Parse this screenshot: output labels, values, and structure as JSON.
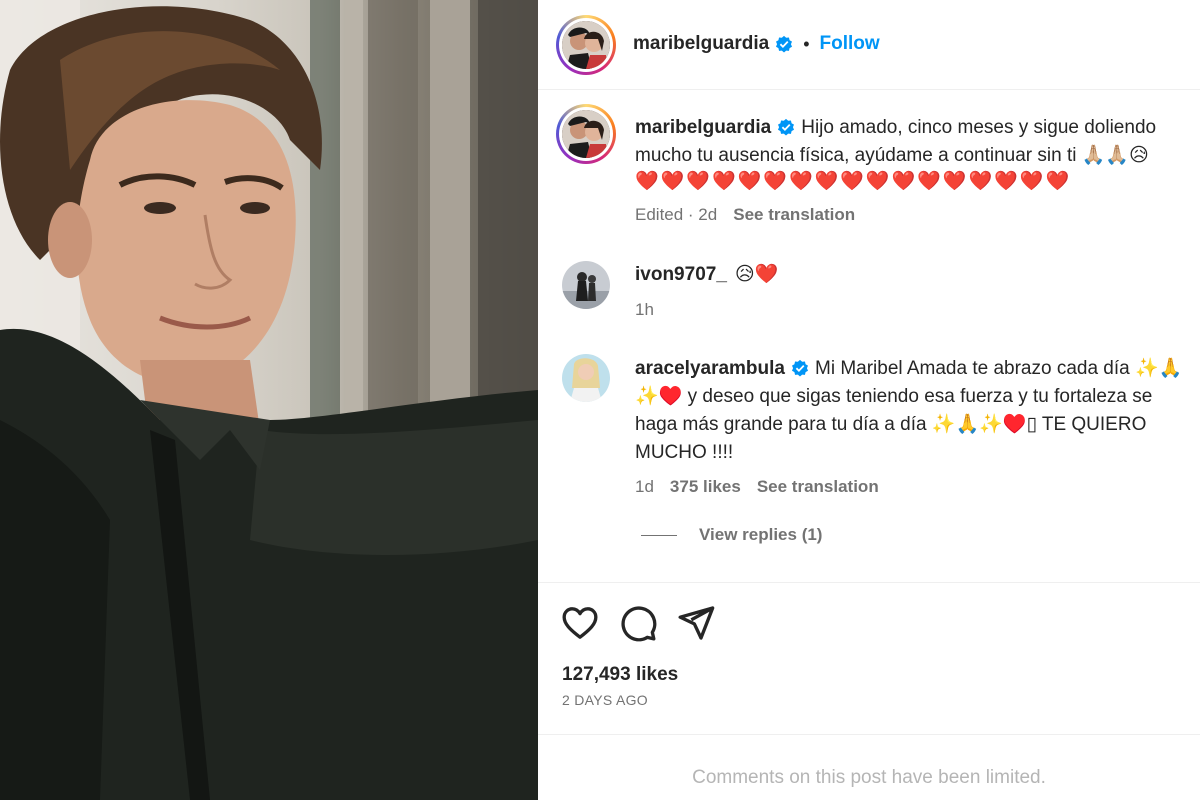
{
  "post": {
    "author": "maribelguardia",
    "follow_label": "Follow",
    "separator": "•"
  },
  "caption": {
    "author": "maribelguardia",
    "text": "Hijo amado, cinco meses y sigue doliendo mucho tu ausencia física, ayúdame a continuar sin ti 🙏🏼🙏🏼😥",
    "hearts": "❤️❤️❤️❤️❤️❤️❤️❤️❤️❤️❤️❤️❤️❤️❤️❤️❤️",
    "edited": "Edited · 2d",
    "see_translation": "See translation"
  },
  "comments": [
    {
      "author": "ivon9707_",
      "text": "😥❤️",
      "time": "1h"
    },
    {
      "author": "aracelyarambula",
      "text": "Mi Maribel Amada te abrazo cada día ✨🙏✨♥️ y deseo que sigas teniendo esa fuerza y tu fortaleza se haga más grande para tu día a día ✨🙏✨♥️▯ TE QUIERO MUCHO !!!!",
      "time": "1d",
      "likes": "375 likes",
      "see_translation": "See translation",
      "view_replies": "View replies (1)"
    }
  ],
  "stats": {
    "likes": "127,493 likes",
    "date": "2 DAYS AGO"
  },
  "footer": {
    "limited": "Comments on this post have been limited."
  },
  "icons": {
    "verified": "verified-badge-icon",
    "like": "heart-icon",
    "comment": "comment-bubble-icon",
    "share": "paper-plane-icon"
  },
  "colors": {
    "accent": "#0095f6",
    "verified": "#0095f6",
    "muted": "#737373",
    "limited": "#b5b5b5"
  }
}
